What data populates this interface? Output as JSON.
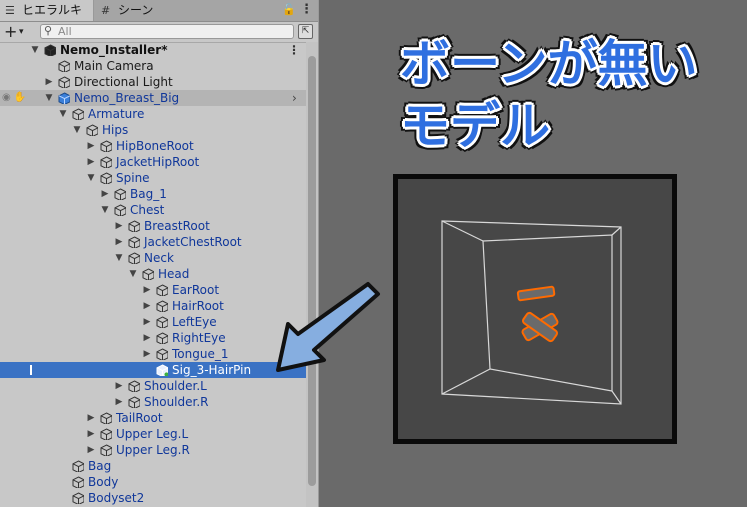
{
  "tabs": {
    "hierarchy": "ヒエラルキー",
    "scene": "シーン",
    "hierarchy_icon": "list-icon",
    "scene_icon": "grid-icon"
  },
  "toolbar": {
    "add_label": "+",
    "add_caret": "▾",
    "search_placeholder": "All"
  },
  "tree": [
    {
      "label": "Nemo_Installer*",
      "kind": "scene",
      "depth": 0,
      "arrow": "down"
    },
    {
      "label": "Main Camera",
      "kind": "normal",
      "depth": 1,
      "arrow": ""
    },
    {
      "label": "Directional Light",
      "kind": "normal",
      "depth": 1,
      "arrow": "right"
    },
    {
      "label": "Nemo_Breast_Big",
      "kind": "prefab-root",
      "depth": 1,
      "arrow": "down"
    },
    {
      "label": "Armature",
      "kind": "prefab",
      "depth": 2,
      "arrow": "down"
    },
    {
      "label": "Hips",
      "kind": "prefab",
      "depth": 3,
      "arrow": "down"
    },
    {
      "label": "HipBoneRoot",
      "kind": "prefab",
      "depth": 4,
      "arrow": "right"
    },
    {
      "label": "JacketHipRoot",
      "kind": "prefab",
      "depth": 4,
      "arrow": "right"
    },
    {
      "label": "Spine",
      "kind": "prefab",
      "depth": 4,
      "arrow": "down"
    },
    {
      "label": "Bag_1",
      "kind": "prefab",
      "depth": 5,
      "arrow": "right"
    },
    {
      "label": "Chest",
      "kind": "prefab",
      "depth": 5,
      "arrow": "down"
    },
    {
      "label": "BreastRoot",
      "kind": "prefab",
      "depth": 6,
      "arrow": "right"
    },
    {
      "label": "JacketChestRoot",
      "kind": "prefab",
      "depth": 6,
      "arrow": "right"
    },
    {
      "label": "Neck",
      "kind": "prefab",
      "depth": 6,
      "arrow": "down"
    },
    {
      "label": "Head",
      "kind": "prefab",
      "depth": 7,
      "arrow": "down"
    },
    {
      "label": "EarRoot",
      "kind": "prefab",
      "depth": 8,
      "arrow": "right"
    },
    {
      "label": "HairRoot",
      "kind": "prefab",
      "depth": 8,
      "arrow": "right"
    },
    {
      "label": "LeftEye",
      "kind": "prefab",
      "depth": 8,
      "arrow": "right"
    },
    {
      "label": "RightEye",
      "kind": "prefab",
      "depth": 8,
      "arrow": "right"
    },
    {
      "label": "Tongue_1",
      "kind": "prefab",
      "depth": 8,
      "arrow": "right"
    },
    {
      "label": "Sig_3-HairPin",
      "kind": "selected",
      "depth": 8,
      "arrow": ""
    },
    {
      "label": "Shoulder.L",
      "kind": "prefab",
      "depth": 6,
      "arrow": "right"
    },
    {
      "label": "Shoulder.R",
      "kind": "prefab",
      "depth": 6,
      "arrow": "right"
    },
    {
      "label": "TailRoot",
      "kind": "prefab",
      "depth": 4,
      "arrow": "right"
    },
    {
      "label": "Upper Leg.L",
      "kind": "prefab",
      "depth": 4,
      "arrow": "right"
    },
    {
      "label": "Upper Leg.R",
      "kind": "prefab",
      "depth": 4,
      "arrow": "right"
    },
    {
      "label": "Bag",
      "kind": "prefab",
      "depth": 2,
      "arrow": ""
    },
    {
      "label": "Body",
      "kind": "prefab",
      "depth": 2,
      "arrow": ""
    },
    {
      "label": "Bodyset2",
      "kind": "prefab",
      "depth": 2,
      "arrow": ""
    }
  ],
  "annotation": {
    "line1": "ボーンが無い",
    "line2": "モデル",
    "text_color": "#2f6fe0",
    "arrow_color": "#86aee0",
    "highlight_color": "#ff6a00"
  },
  "icons": {
    "gameobject": "cube-icon",
    "prefab": "prefab-cube-icon",
    "scene": "unity-scene-icon",
    "lock": "lock-icon",
    "menu": "kebab-menu-icon",
    "search": "search-icon",
    "visibility": "eye-icon"
  },
  "colors": {
    "selection": "#3a72c4",
    "prefab_text": "#10379a",
    "panel_bg": "#c8c8c8",
    "viewport_bg": "#474747"
  }
}
